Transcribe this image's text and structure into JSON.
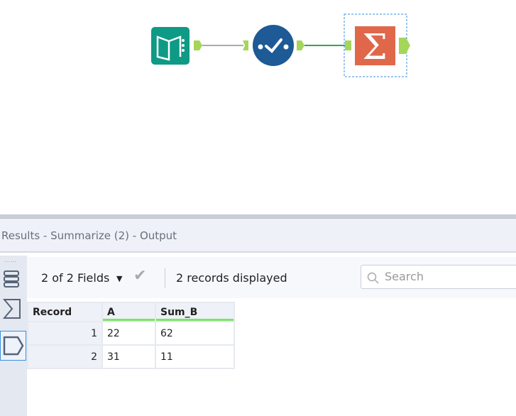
{
  "workflow": {
    "tools": [
      {
        "name": "Input Data",
        "color": "#0e9a85"
      },
      {
        "name": "Select",
        "color": "#1d5a96"
      },
      {
        "name": "Summarize",
        "color": "#e0674a"
      }
    ],
    "anchor_color": "#a5d65a",
    "connection_color": "#2fa84a"
  },
  "results": {
    "title": "Results - Summarize (2) - Output",
    "fields_label": "2 of 2 Fields",
    "records_label": "2 records displayed",
    "search_placeholder": "Search",
    "columns": [
      "Record",
      "A",
      "Sum_B"
    ],
    "rows": [
      {
        "record": "1",
        "A": "22",
        "Sum_B": "62"
      },
      {
        "record": "2",
        "A": "31",
        "Sum_B": "11"
      }
    ]
  }
}
